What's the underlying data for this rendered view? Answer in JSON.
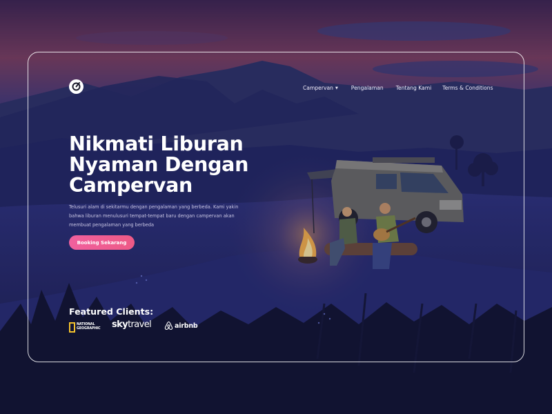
{
  "header": {
    "logo_icon": "camper-logo-icon",
    "nav": [
      {
        "label": "Campervan",
        "has_dropdown": true
      },
      {
        "label": "Pengalaman"
      },
      {
        "label": "Tentang Kami"
      },
      {
        "label": "Terms & Conditions"
      }
    ]
  },
  "hero": {
    "title_lines": [
      "Nikmati Liburan",
      "Nyaman Dengan",
      "Campervan"
    ],
    "description_lines": [
      "Telusuri alam di sekitarmu dengan pengalaman yang berbeda. Kami yakin",
      "bahwa liburan menulusuri tempat-tempat baru dengan campervan akan",
      "membuat pengalaman yang berbeda"
    ],
    "cta_label": "Booking Sekarang"
  },
  "clients": {
    "title": "Featured Clients:",
    "natgeo_lines": [
      "NATIONAL",
      "GEOGRAPHIC"
    ],
    "skytravel": {
      "bold": "sky",
      "regular": "travel"
    },
    "airbnb": "airbnb"
  },
  "colors": {
    "accent": "#ee5a86",
    "frame": "#ffffff",
    "natgeo_yellow": "#f3c12d",
    "night_sky": "#3a2c63"
  }
}
